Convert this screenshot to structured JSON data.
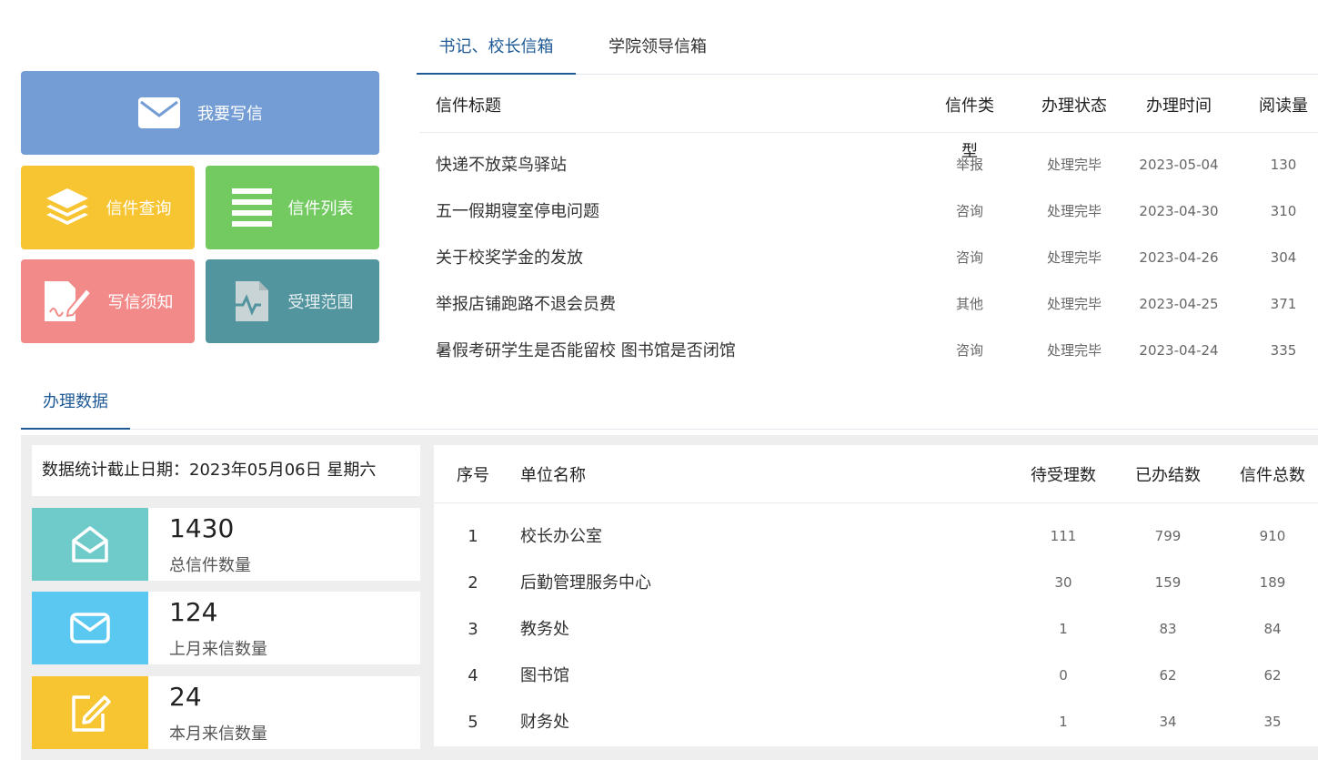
{
  "tiles": {
    "write": "我要写信",
    "query": "信件查询",
    "list": "信件列表",
    "notice": "写信须知",
    "scope": "受理范围"
  },
  "letter_tabs": [
    "书记、校长信箱",
    "学院领导信箱"
  ],
  "letters": {
    "headers": {
      "title": "信件标题",
      "type": "信件类型",
      "status": "办理状态",
      "time": "办理时间",
      "reads": "阅读量"
    },
    "rows": [
      {
        "title": "快递不放菜鸟驿站",
        "type": "举报",
        "status": "处理完毕",
        "time": "2023-05-04",
        "reads": "130"
      },
      {
        "title": "五一假期寝室停电问题",
        "type": "咨询",
        "status": "处理完毕",
        "time": "2023-04-30",
        "reads": "310"
      },
      {
        "title": "关于校奖学金的发放",
        "type": "咨询",
        "status": "处理完毕",
        "time": "2023-04-26",
        "reads": "304"
      },
      {
        "title": "举报店铺跑路不退会员费",
        "type": "其他",
        "status": "处理完毕",
        "time": "2023-04-25",
        "reads": "371"
      },
      {
        "title": "暑假考研学生是否能留校 图书馆是否闭馆",
        "type": "咨询",
        "status": "处理完毕",
        "time": "2023-04-24",
        "reads": "335"
      }
    ]
  },
  "data_tab": "办理数据",
  "stats": {
    "date_line": "数据统计截止日期：2023年05月06日 星期六",
    "cards": [
      {
        "value": "1430",
        "label": "总信件数量",
        "icon": "open-envelope-icon"
      },
      {
        "value": "124",
        "label": "上月来信数量",
        "icon": "envelope-icon"
      },
      {
        "value": "24",
        "label": "本月来信数量",
        "icon": "edit-icon"
      }
    ]
  },
  "units": {
    "headers": {
      "idx": "序号",
      "name": "单位名称",
      "pending": "待受理数",
      "done": "已办结数",
      "total": "信件总数"
    },
    "rows": [
      {
        "idx": "1",
        "name": "校长办公室",
        "pending": "111",
        "done": "799",
        "total": "910"
      },
      {
        "idx": "2",
        "name": "后勤管理服务中心",
        "pending": "30",
        "done": "159",
        "total": "189"
      },
      {
        "idx": "3",
        "name": "教务处",
        "pending": "1",
        "done": "83",
        "total": "84"
      },
      {
        "idx": "4",
        "name": "图书馆",
        "pending": "0",
        "done": "62",
        "total": "62"
      },
      {
        "idx": "5",
        "name": "财务处",
        "pending": "1",
        "done": "34",
        "total": "35"
      }
    ]
  },
  "colors": {
    "accent": "#1f5a96",
    "write": "#739dd4",
    "query": "#f7c432",
    "list": "#72ca61",
    "notice": "#f38a8a",
    "scope": "#52959f",
    "stat_teal": "#6fcbc9",
    "stat_blue": "#5ac8f0",
    "stat_yellow": "#f7c432"
  }
}
